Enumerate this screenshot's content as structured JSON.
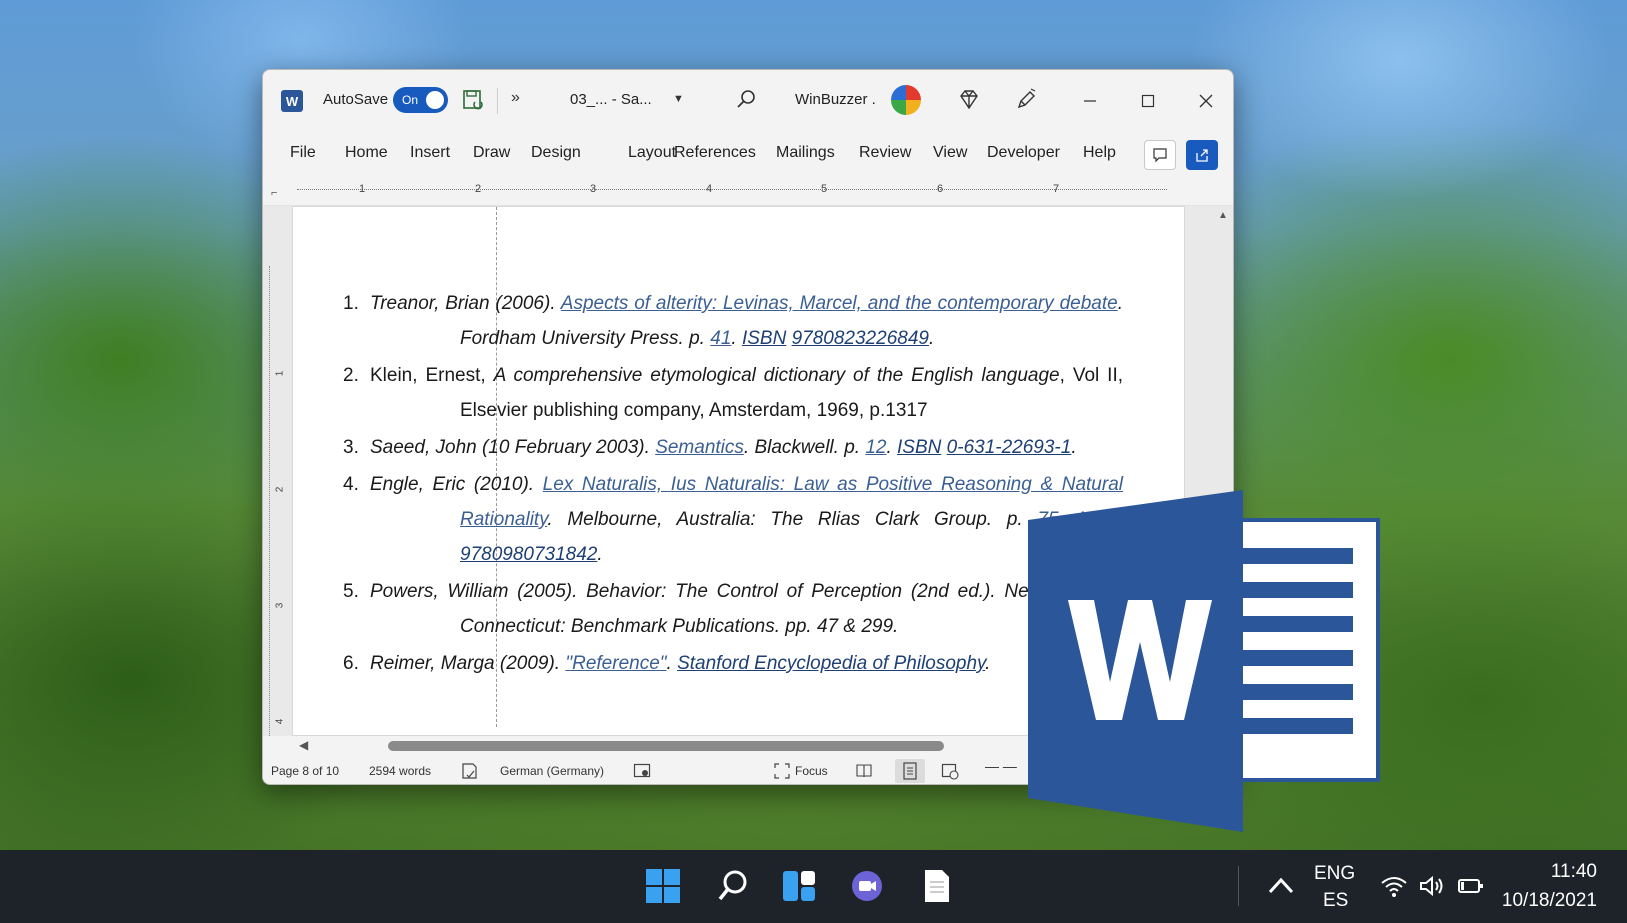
{
  "titlebar": {
    "app_icon_letter": "W",
    "autosave_label": "AutoSave",
    "autosave_state": "On",
    "more_label": "»",
    "doc_title": "03_...   - Sa...",
    "user_name": "WinBuzzer ."
  },
  "menu": {
    "file": "File",
    "home": "Home",
    "insert": "Insert",
    "draw": "Draw",
    "design": "Design",
    "layout": "Layout",
    "references": "References",
    "mailings": "Mailings",
    "review": "Review",
    "view": "View",
    "developer": "Developer",
    "help": "Help"
  },
  "ruler": {
    "numbers": [
      "1",
      "2",
      "3",
      "4",
      "5",
      "6",
      "7"
    ],
    "vertical_numbers": [
      "1",
      "2",
      "3",
      "4"
    ]
  },
  "references": [
    {
      "num": "1.",
      "parts": [
        {
          "t": "Treanor, Brian (2006). ",
          "s": "it"
        },
        {
          "t": "Aspects of alterity: Levinas, Marcel, and the contemporary debate",
          "s": "it lk"
        },
        {
          "t": ". Fordham University Press. p. ",
          "s": "it"
        },
        {
          "t": "41",
          "s": "it lk"
        },
        {
          "t": ". ",
          "s": "it"
        },
        {
          "t": "ISBN",
          "s": "it lk-dark"
        },
        {
          "t": " ",
          "s": "it"
        },
        {
          "t": "9780823226849",
          "s": "it lk-dark"
        },
        {
          "t": ".",
          "s": "it"
        }
      ]
    },
    {
      "num": "2.",
      "parts": [
        {
          "t": "Klein, Ernest, ",
          "s": ""
        },
        {
          "t": "A comprehensive etymological dictionary of the English language",
          "s": "it"
        },
        {
          "t": ", Vol II, Elsevier publishing company, Amsterdam, 1969, p.1317",
          "s": ""
        }
      ]
    },
    {
      "num": "3.",
      "parts": [
        {
          "t": "Saeed, John (10 February 2003). ",
          "s": "it"
        },
        {
          "t": "Semantics",
          "s": "it lk"
        },
        {
          "t": ". Blackwell. p. ",
          "s": "it"
        },
        {
          "t": "12",
          "s": "it lk"
        },
        {
          "t": ". ",
          "s": "it"
        },
        {
          "t": "ISBN",
          "s": "it lk-dark"
        },
        {
          "t": " ",
          "s": "it"
        },
        {
          "t": "0-631-22693-1",
          "s": "it lk-dark"
        },
        {
          "t": ".",
          "s": "it"
        }
      ]
    },
    {
      "num": "4.",
      "parts": [
        {
          "t": "Engle, Eric (2010). ",
          "s": "it"
        },
        {
          "t": "Lex Naturalis, Ius Naturalis: Law as Positive Reasoning & Natural Rationality",
          "s": "it lk"
        },
        {
          "t": ". Melbourne, Australia: The Rlias Clark Group. p. ",
          "s": "it"
        },
        {
          "t": "75",
          "s": "it lk"
        },
        {
          "t": ". ",
          "s": "it"
        },
        {
          "t": "ISBN",
          "s": "it lk-dark"
        },
        {
          "t": " ",
          "s": "it"
        },
        {
          "t": "9780980731842",
          "s": "it lk-dark"
        },
        {
          "t": ".",
          "s": "it"
        }
      ]
    },
    {
      "num": "5.",
      "parts": [
        {
          "t": "Powers, William (2005). Behavior: The Control of Perception (2nd ed.). New Canaan, Connecticut: Benchmark Publications. pp. 47 & 299.",
          "s": "it"
        }
      ]
    },
    {
      "num": "6.",
      "parts": [
        {
          "t": "Reimer, Marga (2009). ",
          "s": "it"
        },
        {
          "t": "\"Reference\"",
          "s": "it lk"
        },
        {
          "t": ". ",
          "s": "it"
        },
        {
          "t": "Stanford Encyclopedia of Philosophy",
          "s": "it lk-dark"
        },
        {
          "t": ".",
          "s": "it"
        }
      ]
    }
  ],
  "statusbar": {
    "page": "Page 8 of 10",
    "words": "2594 words",
    "language": "German (Germany)",
    "focus": "Focus",
    "zoom": "—  —"
  },
  "logo": {
    "letter": "W",
    "color": "#2b579a"
  },
  "tray": {
    "lang_line1": "ENG",
    "lang_line2": "ES",
    "time": "11:40",
    "date": "10/18/2021"
  },
  "colors": {
    "word_blue": "#185abd",
    "link": "#3b5f93",
    "taskbar": "#1d2329"
  }
}
